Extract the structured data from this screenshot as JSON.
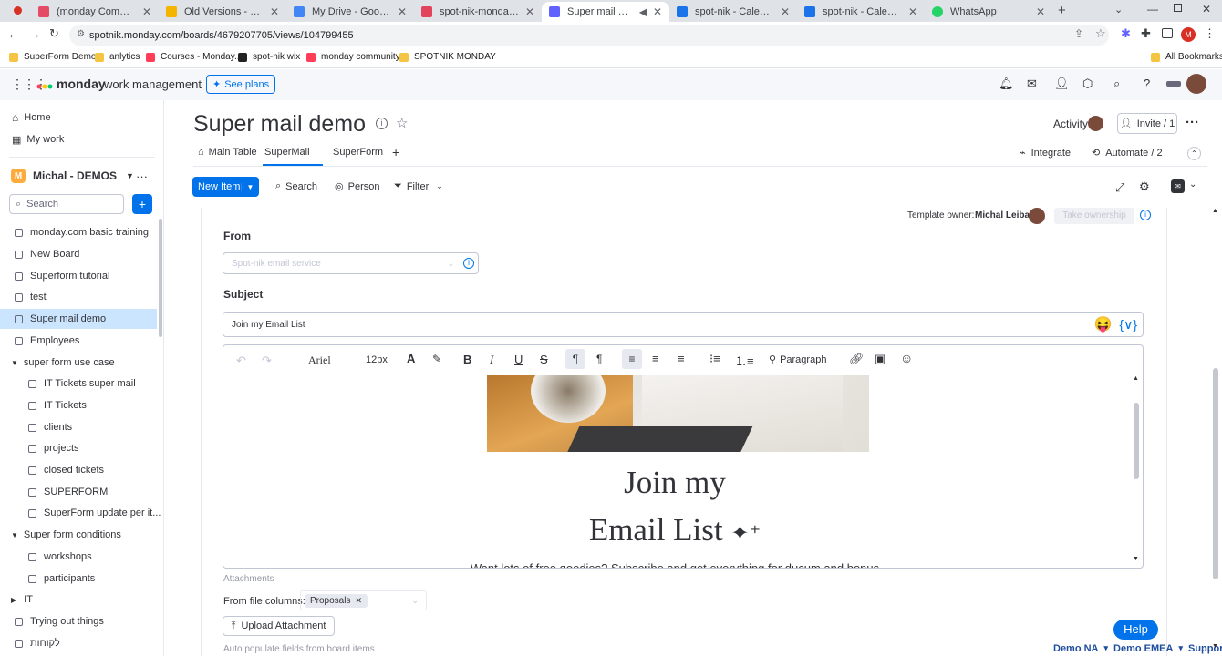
{
  "browser": {
    "tabs": [
      {
        "title": "(monday Community Fo",
        "color": "#e44c65"
      },
      {
        "title": "Old Versions - Google Dr",
        "color": "#f4b400"
      },
      {
        "title": "My Drive - Google Drive",
        "color": "#4285f4"
      },
      {
        "title": "spot-nik-monday - Spot",
        "color": "#e2445c"
      },
      {
        "title": "Super mail demo",
        "color": "#6161ff"
      },
      {
        "title": "spot-nik - Calendar - W",
        "color": "#1a73e8"
      },
      {
        "title": "spot-nik - Calendar - W",
        "color": "#1a73e8"
      },
      {
        "title": "WhatsApp",
        "color": "#25d366"
      }
    ],
    "url": "spotnik.monday.com/boards/4679207705/views/104799455",
    "bookmarks": [
      "SuperForm Demo",
      "anlytics",
      "Courses - Monday...",
      "spot-nik wix",
      "monday community",
      "SPOTNIK MONDAY"
    ],
    "all_bookmarks": "All Bookmarks"
  },
  "app": {
    "brand": "monday",
    "brand_sub": "work management",
    "see_plans": "See plans"
  },
  "sidebar": {
    "home": "Home",
    "my_work": "My work",
    "workspace_initial": "M",
    "workspace": "Michal - DEMOS",
    "search_placeholder": "Search",
    "items": [
      {
        "label": "monday.com basic training"
      },
      {
        "label": "New Board"
      },
      {
        "label": "Superform tutorial"
      },
      {
        "label": "test"
      },
      {
        "label": "Super mail demo"
      },
      {
        "label": "Employees"
      }
    ],
    "folder1": "super form use case",
    "folder1_items": [
      "IT Tickets super mail",
      "IT Tickets",
      "clients",
      "projects",
      "closed tickets",
      "SUPERFORM",
      "SuperForm update per it..."
    ],
    "folder2": "Super form conditions",
    "folder2_items": [
      "workshops",
      "participants"
    ],
    "folder3": "IT",
    "extra_items": [
      "Trying out things",
      "לקוחות"
    ]
  },
  "board": {
    "title": "Super mail demo",
    "activity": "Activity",
    "invite": "Invite / 1",
    "tabs": [
      "Main Table",
      "SuperMail",
      "SuperForm"
    ],
    "integrate": "Integrate",
    "automate": "Automate / 2",
    "new_item": "New Item",
    "search": "Search",
    "person": "Person",
    "filter": "Filter"
  },
  "mail": {
    "template_owner_label": "Template owner:",
    "template_owner": "Michal Leiba",
    "take_ownership": "Take ownership",
    "from_label": "From",
    "from_placeholder": "Spot-nik email service",
    "subject_label": "Subject",
    "subject_value": "Join my Email List",
    "variable_btn": "{∨}",
    "font": "Ariel",
    "font_size": "12px",
    "paragraph": "Paragraph",
    "heading_line1": "Join my",
    "heading_line2": "Email List",
    "body_cut": "Want lots of free goodies? Subscribe and get everything for ducum and bonus",
    "attachments_label": "Attachments",
    "from_file_columns": "From file columns:",
    "file_chip": "Proposals",
    "upload": "Upload Attachment",
    "auto_populate": "Auto populate fields from board items",
    "help": "Help",
    "footer_links": [
      "Demo NA",
      "Demo EMEA",
      "Support"
    ]
  }
}
